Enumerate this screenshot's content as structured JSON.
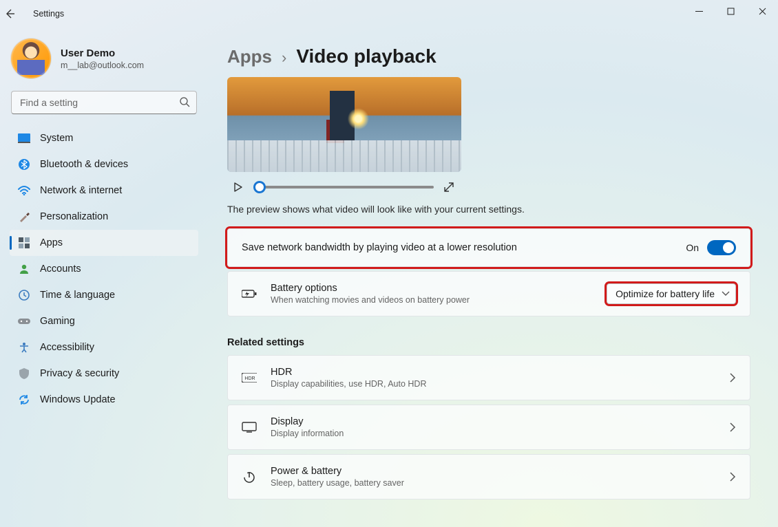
{
  "window": {
    "title": "Settings"
  },
  "user": {
    "name": "User Demo",
    "email": "m__lab@outlook.com"
  },
  "search": {
    "placeholder": "Find a setting"
  },
  "nav": {
    "items": [
      {
        "label": "System"
      },
      {
        "label": "Bluetooth & devices"
      },
      {
        "label": "Network & internet"
      },
      {
        "label": "Personalization"
      },
      {
        "label": "Apps"
      },
      {
        "label": "Accounts"
      },
      {
        "label": "Time & language"
      },
      {
        "label": "Gaming"
      },
      {
        "label": "Accessibility"
      },
      {
        "label": "Privacy & security"
      },
      {
        "label": "Windows Update"
      }
    ],
    "selected_index": 4
  },
  "breadcrumb": {
    "parent": "Apps",
    "current": "Video playback"
  },
  "preview_caption": "The preview shows what video will look like with your current settings.",
  "settings": {
    "bandwidth": {
      "label": "Save network bandwidth by playing video at a lower resolution",
      "state_text": "On",
      "value": true
    },
    "battery": {
      "title": "Battery options",
      "subtitle": "When watching movies and videos on battery power",
      "selected": "Optimize for battery life"
    }
  },
  "related": {
    "heading": "Related settings",
    "items": [
      {
        "title": "HDR",
        "subtitle": "Display capabilities, use HDR, Auto HDR",
        "icon": "hdr"
      },
      {
        "title": "Display",
        "subtitle": "Display information",
        "icon": "display"
      },
      {
        "title": "Power & battery",
        "subtitle": "Sleep, battery usage, battery saver",
        "icon": "power"
      }
    ]
  }
}
